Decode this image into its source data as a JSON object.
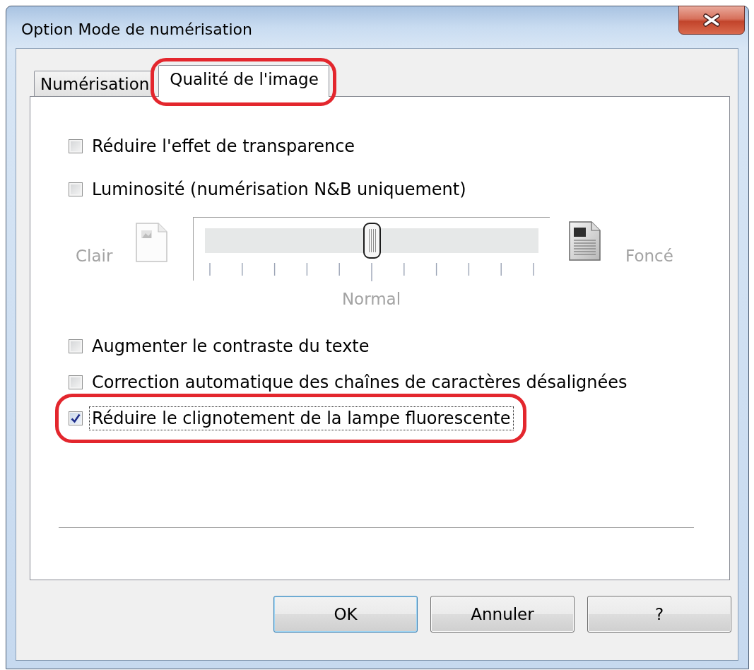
{
  "window": {
    "title": "Option Mode de numérisation"
  },
  "tabs": [
    {
      "label": "Numérisation",
      "selected": false,
      "highlighted": false
    },
    {
      "label": "Qualité de l'image",
      "selected": true,
      "highlighted": true
    }
  ],
  "options": [
    {
      "kind": "checkbox",
      "label": "Réduire l'effet de transparence",
      "checked": false,
      "focused": false,
      "highlighted": false
    },
    {
      "kind": "checkbox",
      "label": "Luminosité (numérisation N&B uniquement)",
      "checked": false,
      "focused": false,
      "highlighted": false
    },
    {
      "kind": "slider",
      "min_label": "Clair",
      "max_label": "Foncé",
      "center_label": "Normal",
      "level": 0.5,
      "disabled": true
    },
    {
      "kind": "checkbox",
      "label": "Augmenter le contraste du texte",
      "checked": false,
      "focused": false,
      "highlighted": false
    },
    {
      "kind": "checkbox",
      "label": "Correction automatique des chaînes de caractères désalignées",
      "checked": false,
      "focused": false,
      "highlighted": false
    },
    {
      "kind": "checkbox",
      "label": "Réduire le clignotement de la lampe fluorescente",
      "checked": true,
      "focused": true,
      "highlighted": true
    }
  ],
  "buttons": [
    {
      "label": "OK",
      "default": true
    },
    {
      "label": "Annuler",
      "default": false
    },
    {
      "label": "?",
      "default": false
    }
  ]
}
